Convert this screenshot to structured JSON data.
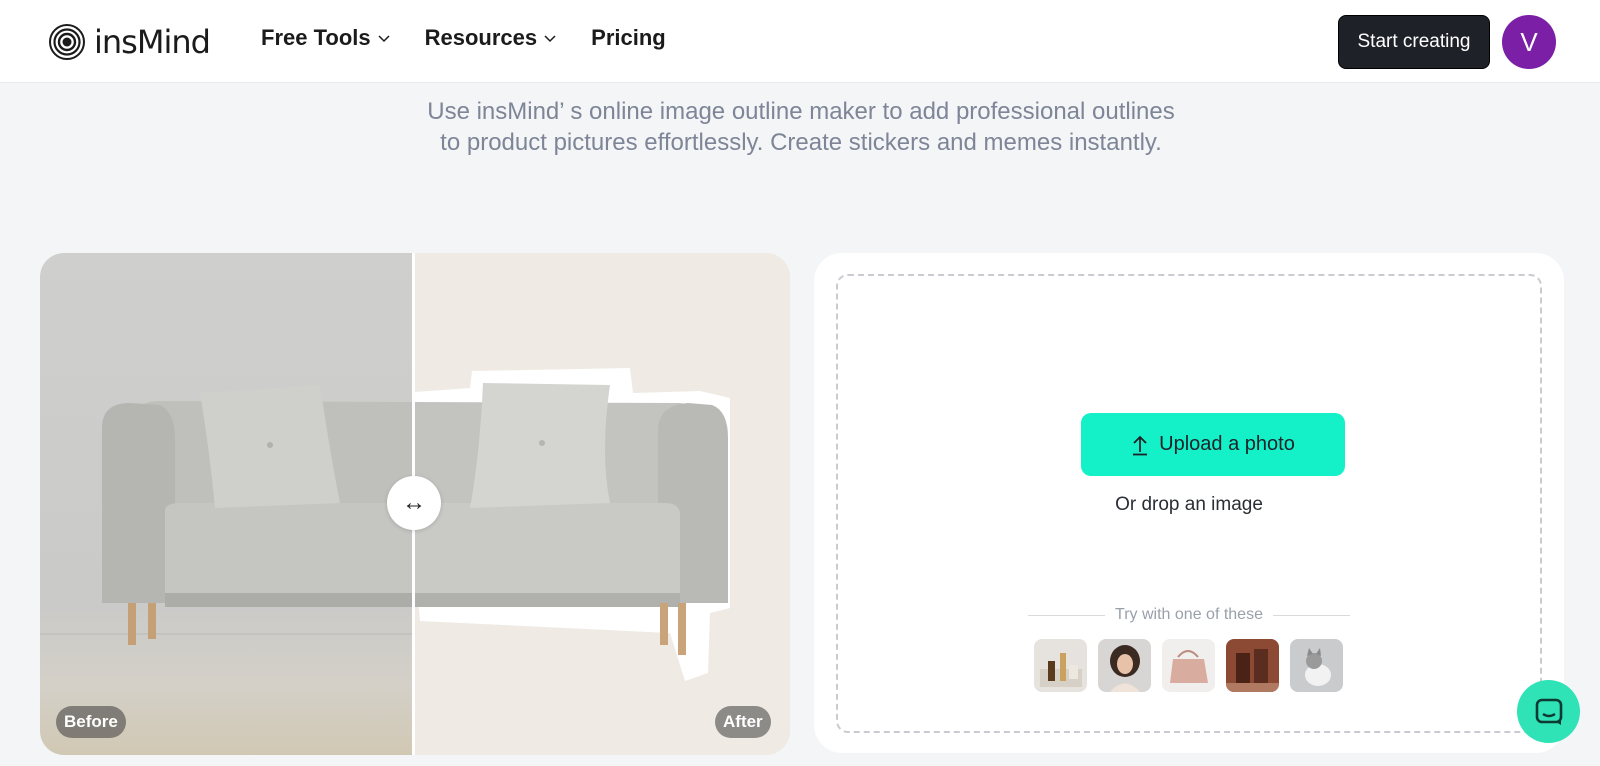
{
  "header": {
    "logo_text": "insMind",
    "nav": [
      {
        "label": "Free Tools",
        "has_dropdown": true
      },
      {
        "label": "Resources",
        "has_dropdown": true
      },
      {
        "label": "Pricing",
        "has_dropdown": false
      }
    ],
    "cta_label": "Start creating",
    "avatar_initial": "V",
    "avatar_color": "#7a1fa6"
  },
  "hero": {
    "description": "Use insMind’ s online image outline maker to add professional outlines to product pictures effortlessly. Create stickers and memes instantly."
  },
  "compare": {
    "before_label": "Before",
    "after_label": "After",
    "handle_glyph": "↔"
  },
  "upload": {
    "button_label": "Upload a photo",
    "drop_text": "Or drop an image",
    "try_text": "Try with one of these",
    "accent_color": "#14f0c8",
    "samples": [
      "cosmetics-sample",
      "woman-portrait-sample",
      "handbag-sample",
      "skincare-bottles-sample",
      "cat-sample"
    ]
  },
  "chat": {
    "icon": "chat-icon"
  }
}
